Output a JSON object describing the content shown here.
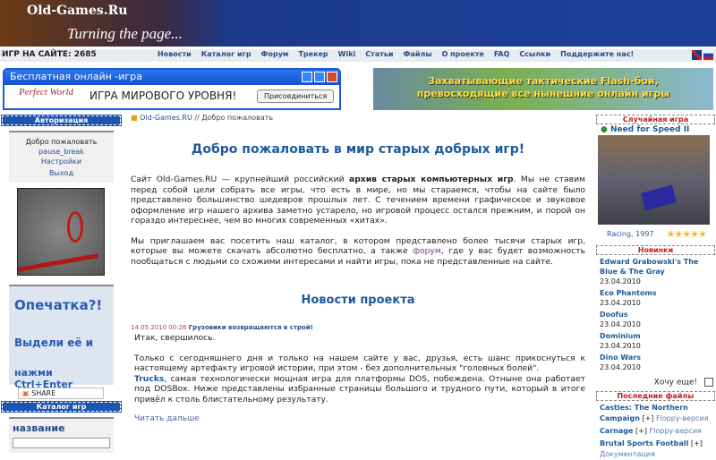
{
  "site": {
    "logo": "Old-Games.Ru",
    "tagline": "Turning the page..."
  },
  "navbar": {
    "games_count": "ИГР НА САЙТЕ: 2685",
    "items": [
      "Новости",
      "Каталог игр",
      "Форум",
      "Трекер",
      "Wiki",
      "Статьи",
      "Файлы",
      "О проекте",
      "FAQ",
      "Ссылки",
      "Поддержите нас!"
    ]
  },
  "ads": {
    "left": {
      "title": "Бесплатная онлайн -игра",
      "logo": "Perfect World",
      "text": "ИГРА МИРОВОГО УРОВНЯ!",
      "button": "Присоединиться"
    },
    "right": {
      "line1": "Захватывающие тактические Flash-бои,",
      "line2": "превосходящие все нынешние онлайн игры"
    }
  },
  "left": {
    "auth_title": "Авторизация",
    "welcome": "Добро пожаловать",
    "user": "pause_break",
    "settings": "Настройки",
    "logout": "Выход",
    "typo_line1": "Опечатка?!",
    "typo_line2": "Выдели её и",
    "typo_line3": "нажми Ctrl+Enter",
    "share": "SHARE",
    "catalog_title": "Каталог игр",
    "catalog_label": "название"
  },
  "center": {
    "breadcrumb_home": "Old-Games.RU",
    "breadcrumb_sep": " // ",
    "breadcrumb_current": "Добро пожаловать",
    "title": "Добро пожаловать в мир старых добрых игр!",
    "p1_a": "Сайт Old-Games.RU — крупнейший российский ",
    "p1_b": "архив старых компьютерных игр",
    "p1_c": ". Мы не ставим перед собой цели собрать все игры, что есть в мире, но мы стараемся, чтобы на сайте было представлено большинство шедевров прошлых лет. С течением времени графическое и звуковое оформление игр нашего архива заметно устарело, но игровой процесс остался прежним, и порой он гораздо интереснее, чем во многих современных «хитах».",
    "p2_a": "Мы приглашаем вас посетить наш каталог, в котором представлено более тысячи старых игр, которые вы можете скачать абсолютно бесплатно, а также ",
    "p2_link": "форум",
    "p2_b": ", где у вас будет возможность пообщаться с людьми со схожими интересами и найти игры, пока не представленные на сайте.",
    "news_title": "Новости проекта",
    "news_date": "14.05.2010 00:26",
    "news_headline": "Грузовики возвращаются в строй!",
    "news_p1": "Итак, свершилось.",
    "news_p2": "Только с сегодняшнего дня и только на нашем сайте у вас, друзья, есть шанс прикоснуться к настоящему артефакту игровой истории, при этом - без дополнительных \"головных болей\".",
    "news_link": "Trucks",
    "news_p3": ", самая технологически мощная игра для платформы DOS, побеждена. Отныне она работает под DOSBox. Ниже представлены избранные страницы большого и трудного пути, который в итоге привёл к столь блистательному результату.",
    "read_more": "Читать дальше"
  },
  "right": {
    "random_title": "Случайная игра",
    "game": "Need for Speed II",
    "game_meta": "Racing, 1997",
    "rating": 5,
    "stars": "★★★★★",
    "new_title": "Новинки",
    "new_items": [
      {
        "name": "Edward Grabowski's The Blue & The Gray",
        "date": "23.04.2010"
      },
      {
        "name": "Eco Phantoms",
        "date": "23.04.2010"
      },
      {
        "name": "Doofus",
        "date": "23.04.2010"
      },
      {
        "name": "Dominium",
        "date": "23.04.2010"
      },
      {
        "name": "Dino Wars",
        "date": "23.04.2010"
      }
    ],
    "want_more": "Хочу еще!",
    "files_title": "Последние файлы",
    "files": [
      {
        "name": "Castles: The Northern Campaign",
        "plus": "[+]",
        "type": "Floppy-версия"
      },
      {
        "name": "Carnage",
        "plus": "[+]",
        "type": "Floppy-версия"
      },
      {
        "name": "Brutal Sports Football",
        "plus": "[+]",
        "type": "Документация"
      }
    ]
  }
}
